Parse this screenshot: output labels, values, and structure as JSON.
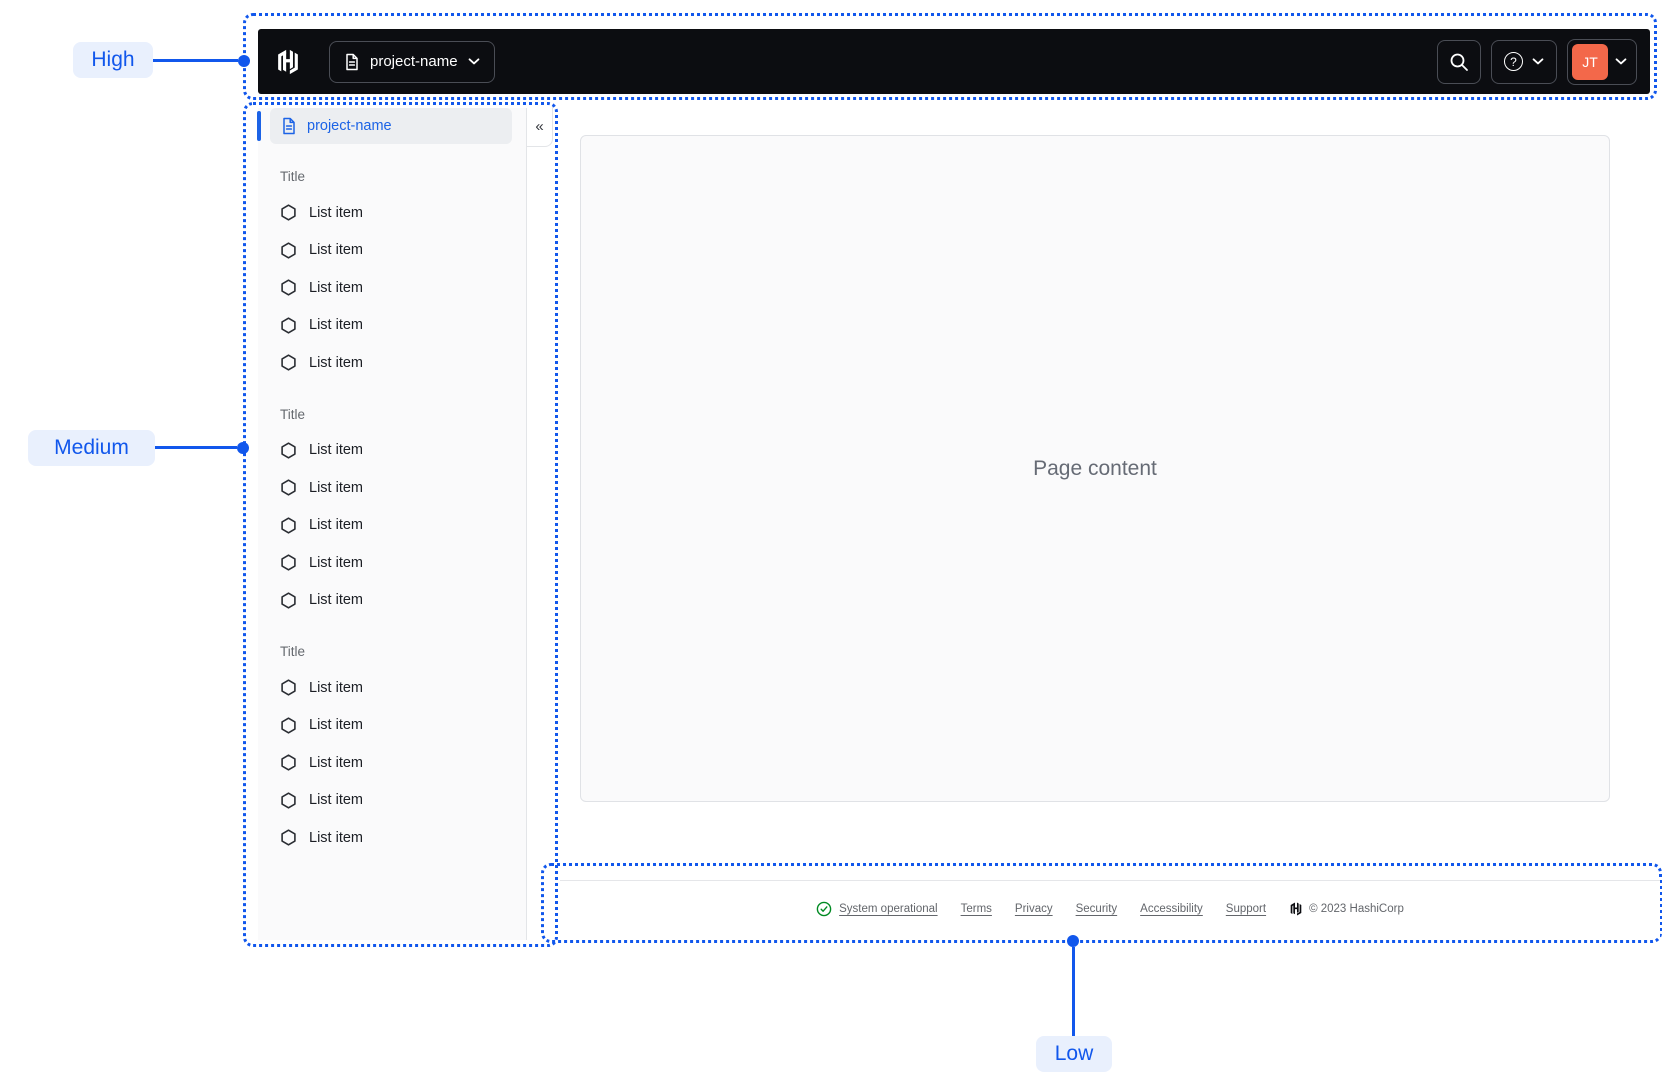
{
  "annotations": {
    "high": {
      "label": "High"
    },
    "medium": {
      "label": "Medium"
    },
    "low": {
      "label": "Low"
    }
  },
  "navbar": {
    "project_switcher": {
      "label": "project-name"
    },
    "help_icon_glyph": "?",
    "avatar": {
      "initials": "JT"
    }
  },
  "sidebar": {
    "header": {
      "label": "project-name"
    },
    "collapse_icon": "«",
    "sections": [
      {
        "title": "Title",
        "items": [
          "List item",
          "List item",
          "List item",
          "List item",
          "List item"
        ]
      },
      {
        "title": "Title",
        "items": [
          "List item",
          "List item",
          "List item",
          "List item",
          "List item"
        ]
      },
      {
        "title": "Title",
        "items": [
          "List item",
          "List item",
          "List item",
          "List item",
          "List item"
        ]
      }
    ]
  },
  "main": {
    "placeholder": "Page content"
  },
  "footer": {
    "status": {
      "label": "System operational"
    },
    "links": [
      "Terms",
      "Privacy",
      "Security",
      "Accessibility",
      "Support"
    ],
    "copyright": "© 2023 HashiCorp"
  },
  "colors": {
    "annotation_blue": "#1157EC",
    "annotation_pill_bg": "#E9F0FD",
    "navbar_bg": "#0C0D11",
    "accent_blue": "#1C63E6",
    "avatar_bg": "#F3684A",
    "status_green": "#008A22"
  }
}
